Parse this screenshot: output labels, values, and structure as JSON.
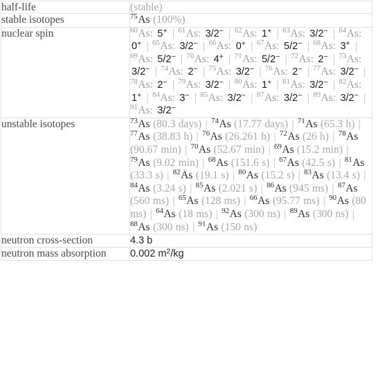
{
  "table": {
    "rows": [
      {
        "label": "half-life",
        "type": "plain-muted",
        "value": "(stable)"
      },
      {
        "label": "stable isotopes",
        "type": "isotope-list",
        "items": [
          {
            "mass": "75",
            "symbol": "As",
            "detail": "(100%)"
          }
        ]
      },
      {
        "label": "nuclear spin",
        "type": "spin-list",
        "items": [
          {
            "mass": "60",
            "symbol": "As",
            "spin": "5",
            "charge": "+"
          },
          {
            "mass": "61",
            "symbol": "As",
            "spin": "3/2",
            "charge": "−"
          },
          {
            "mass": "62",
            "symbol": "As",
            "spin": "1",
            "charge": "+"
          },
          {
            "mass": "63",
            "symbol": "As",
            "spin": "3/2",
            "charge": "−"
          },
          {
            "mass": "64",
            "symbol": "As",
            "spin": "0",
            "charge": "+"
          },
          {
            "mass": "65",
            "symbol": "As",
            "spin": "3/2",
            "charge": "−"
          },
          {
            "mass": "66",
            "symbol": "As",
            "spin": "0",
            "charge": "+"
          },
          {
            "mass": "67",
            "symbol": "As",
            "spin": "5/2",
            "charge": "−"
          },
          {
            "mass": "68",
            "symbol": "As",
            "spin": "3",
            "charge": "+"
          },
          {
            "mass": "69",
            "symbol": "As",
            "spin": "5/2",
            "charge": "−"
          },
          {
            "mass": "70",
            "symbol": "As",
            "spin": "4",
            "charge": "+"
          },
          {
            "mass": "71",
            "symbol": "As",
            "spin": "5/2",
            "charge": "−"
          },
          {
            "mass": "72",
            "symbol": "As",
            "spin": "2",
            "charge": "−"
          },
          {
            "mass": "73",
            "symbol": "As",
            "spin": "3/2",
            "charge": "−"
          },
          {
            "mass": "74",
            "symbol": "As",
            "spin": "2",
            "charge": "−"
          },
          {
            "mass": "75",
            "symbol": "As",
            "spin": "3/2",
            "charge": "−"
          },
          {
            "mass": "76",
            "symbol": "As",
            "spin": "2",
            "charge": "−"
          },
          {
            "mass": "77",
            "symbol": "As",
            "spin": "3/2",
            "charge": "−"
          },
          {
            "mass": "78",
            "symbol": "As",
            "spin": "2",
            "charge": "−"
          },
          {
            "mass": "79",
            "symbol": "As",
            "spin": "3/2",
            "charge": "−"
          },
          {
            "mass": "80",
            "symbol": "As",
            "spin": "1",
            "charge": "+"
          },
          {
            "mass": "81",
            "symbol": "As",
            "spin": "3/2",
            "charge": "−"
          },
          {
            "mass": "82",
            "symbol": "As",
            "spin": "1",
            "charge": "+"
          },
          {
            "mass": "84",
            "symbol": "As",
            "spin": "3",
            "charge": "−"
          },
          {
            "mass": "85",
            "symbol": "As",
            "spin": "3/2",
            "charge": "−"
          },
          {
            "mass": "87",
            "symbol": "As",
            "spin": "3/2",
            "charge": "−"
          },
          {
            "mass": "89",
            "symbol": "As",
            "spin": "3/2",
            "charge": "−"
          },
          {
            "mass": "91",
            "symbol": "As",
            "spin": "3/2",
            "charge": "−"
          }
        ]
      },
      {
        "label": "unstable isotopes",
        "type": "isotope-list",
        "items": [
          {
            "mass": "73",
            "symbol": "As",
            "detail": "(80.3 days)"
          },
          {
            "mass": "74",
            "symbol": "As",
            "detail": "(17.77 days)"
          },
          {
            "mass": "71",
            "symbol": "As",
            "detail": "(65.3 h)"
          },
          {
            "mass": "77",
            "symbol": "As",
            "detail": "(38.83 h)"
          },
          {
            "mass": "76",
            "symbol": "As",
            "detail": "(26.261 h)"
          },
          {
            "mass": "72",
            "symbol": "As",
            "detail": "(26 h)"
          },
          {
            "mass": "78",
            "symbol": "As",
            "detail": "(90.67 min)"
          },
          {
            "mass": "70",
            "symbol": "As",
            "detail": "(52.67 min)"
          },
          {
            "mass": "69",
            "symbol": "As",
            "detail": "(15.2 min)"
          },
          {
            "mass": "79",
            "symbol": "As",
            "detail": "(9.02 min)"
          },
          {
            "mass": "68",
            "symbol": "As",
            "detail": "(151.6 s)"
          },
          {
            "mass": "67",
            "symbol": "As",
            "detail": "(42.5 s)"
          },
          {
            "mass": "81",
            "symbol": "As",
            "detail": "(33.3 s)"
          },
          {
            "mass": "82",
            "symbol": "As",
            "detail": "(19.1 s)"
          },
          {
            "mass": "80",
            "symbol": "As",
            "detail": "(15.2 s)"
          },
          {
            "mass": "83",
            "symbol": "As",
            "detail": "(13.4 s)"
          },
          {
            "mass": "84",
            "symbol": "As",
            "detail": "(3.24 s)"
          },
          {
            "mass": "85",
            "symbol": "As",
            "detail": "(2.021 s)"
          },
          {
            "mass": "86",
            "symbol": "As",
            "detail": "(945 ms)"
          },
          {
            "mass": "87",
            "symbol": "As",
            "detail": "(560 ms)"
          },
          {
            "mass": "65",
            "symbol": "As",
            "detail": "(128 ms)"
          },
          {
            "mass": "66",
            "symbol": "As",
            "detail": "(95.77 ms)"
          },
          {
            "mass": "90",
            "symbol": "As",
            "detail": "(80 ms)"
          },
          {
            "mass": "64",
            "symbol": "As",
            "detail": "(18 ms)"
          },
          {
            "mass": "92",
            "symbol": "As",
            "detail": "(300 ns)"
          },
          {
            "mass": "89",
            "symbol": "As",
            "detail": "(300 ns)"
          },
          {
            "mass": "88",
            "symbol": "As",
            "detail": "(300 ns)"
          },
          {
            "mass": "91",
            "symbol": "As",
            "detail": "(150 ns)"
          }
        ]
      },
      {
        "label": "neutron cross-section",
        "type": "sans",
        "value": "4.3 b"
      },
      {
        "label": "neutron mass absorption",
        "type": "sans-sup",
        "value_pre": "0.002 m",
        "value_sup": "2",
        "value_post": "/kg"
      }
    ],
    "separator": "|",
    "colors": {
      "border": "#e2e2e2",
      "label_text": "#4a4a4a",
      "value_text": "#2e2e2e",
      "muted_text": "#a8a8a8",
      "separator": "#b9b9b9",
      "background": "#ffffff"
    }
  }
}
